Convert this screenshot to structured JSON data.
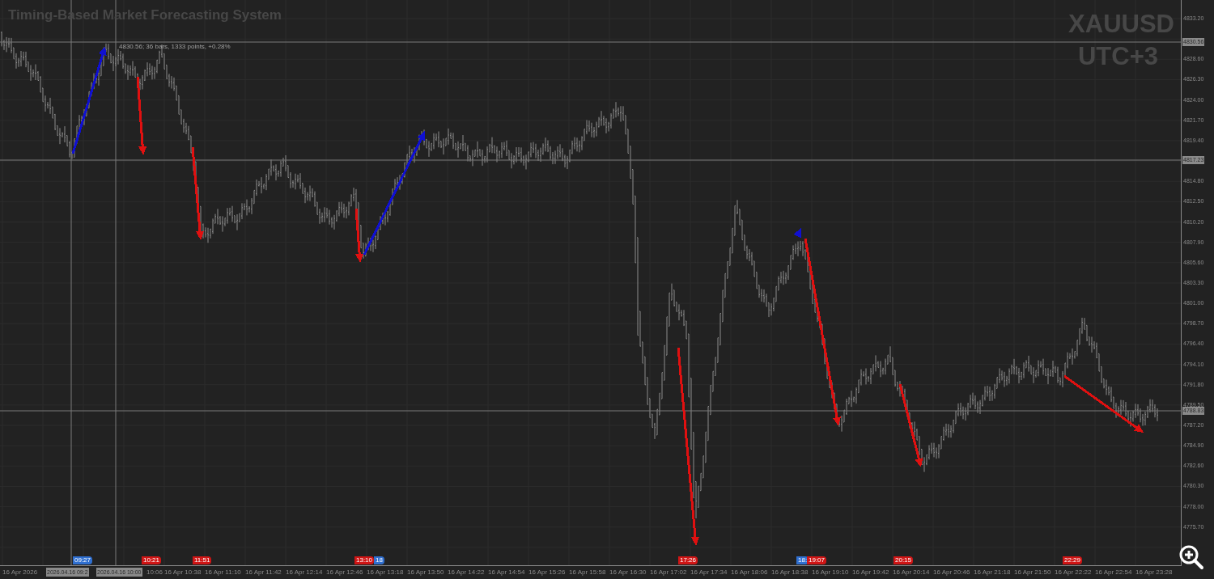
{
  "title": "Timing-Based Market Forecasting System",
  "symbol": "XAUUSD",
  "timezone": "UTC+3",
  "measure_label": "4830.56; 36 bars, 1333 points, +0.28%",
  "price_ticks": [
    "4833.20",
    "4828.60",
    "4826.30",
    "4824.00",
    "4821.70",
    "4819.40",
    "4814.80",
    "4812.50",
    "4810.20",
    "4807.90",
    "4805.60",
    "4803.30",
    "4801.00",
    "4798.70",
    "4796.40",
    "4794.10",
    "4791.80",
    "4789.50",
    "4787.20",
    "4784.90",
    "4782.60",
    "4780.30",
    "4778.00",
    "4775.70"
  ],
  "price_tags": [
    "4830.56",
    "4817.23",
    "4788.83"
  ],
  "signals": [
    {
      "color": "#1010d0"
    },
    {
      "color": "#e01010"
    },
    {
      "color": "#e01010"
    },
    {
      "color": "#e01010"
    },
    {
      "color": "#1010d0"
    },
    {
      "color": "#e01010"
    },
    {
      "color": "#1010d0"
    },
    {
      "color": "#e01010"
    },
    {
      "color": "#e01010"
    },
    {
      "color": "#e01010"
    }
  ],
  "time_markers": [
    {
      "label": "09:27",
      "color": "#2f6fd0"
    },
    {
      "label": "10:21",
      "color": "#d01515"
    },
    {
      "label": "11:51",
      "color": "#d01515"
    },
    {
      "label": "13:10",
      "color": "#d01515"
    },
    {
      "label": "18",
      "color": "#2f6fd0"
    },
    {
      "label": "17:26",
      "color": "#d01515"
    },
    {
      "label": "18:",
      "color": "#2f6fd0"
    },
    {
      "label": "19:07",
      "color": "#d01515"
    },
    {
      "label": "20:15",
      "color": "#d01515"
    },
    {
      "label": "22:29",
      "color": "#d01515"
    }
  ],
  "time_ticks": [
    "16 Apr 2026",
    "10:06",
    "16 Apr 10:38",
    "16 Apr 11:10",
    "16 Apr 11:42",
    "16 Apr 12:14",
    "16 Apr 12:46",
    "16 Apr 13:18",
    "16 Apr 13:50",
    "16 Apr 14:22",
    "16 Apr 14:54",
    "16 Apr 15:26",
    "16 Apr 15:58",
    "16 Apr 16:30",
    "16 Apr 17:02",
    "16 Apr 17:34",
    "16 Apr 18:06",
    "16 Apr 18:38",
    "16 Apr 19:10",
    "16 Apr 19:42",
    "16 Apr 20:14",
    "16 Apr 20:46",
    "16 Apr 21:18",
    "16 Apr 21:50",
    "16 Apr 22:22",
    "16 Apr 22:54",
    "16 Apr 23:28"
  ],
  "crosshair_times": [
    "2026.04.16 09:2",
    "2026.04.16 10:00"
  ]
}
